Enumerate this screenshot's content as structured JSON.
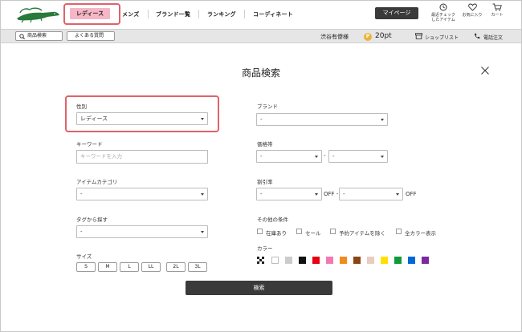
{
  "header": {
    "nav": {
      "ladies": "レディース",
      "mens": "メンズ",
      "brands": "ブランド一覧",
      "ranking": "ランキング",
      "coordinate": "コーディネート"
    },
    "mypage": "マイページ",
    "recent_line1": "最近チェック",
    "recent_line2": "したアイテム",
    "favorites": "お気に入り",
    "cart": "カート"
  },
  "subbar": {
    "product_search": "商品検索",
    "faq": "よくある質問",
    "user": "渋谷有傻様",
    "points": "20pt",
    "shop_list": "ショップリスト",
    "phone_order": "電話注文"
  },
  "panel": {
    "title": "商品検索",
    "gender_label": "性別",
    "gender_value": "レディース",
    "keyword_label": "キーワード",
    "keyword_placeholder": "キーワードを入力",
    "category_label": "アイテムカテゴリ",
    "category_value": "-",
    "tag_label": "タグから探す",
    "tag_value": "-",
    "size_label": "サイズ",
    "sizes": [
      "S",
      "M",
      "L",
      "LL",
      "2L",
      "3L"
    ],
    "brand_label": "ブランド",
    "brand_value": "-",
    "price_label": "価格帯",
    "price_min": "-",
    "price_max": "-",
    "price_dash": "-",
    "discount_label": "割引率",
    "discount_min": "-",
    "discount_max": "-",
    "off_text": "OFF -",
    "off_text_end": "OFF",
    "other_label": "その他の条件",
    "conditions": [
      "在庫あり",
      "セール",
      "予約アイテムを除く",
      "全カラー表示"
    ],
    "color_label": "カラー",
    "colors": [
      "#ffffff",
      "#cccccc",
      "#111111",
      "#e60012",
      "#f279b5",
      "#f08c1e",
      "#8b4513",
      "#e9cdbf",
      "#ffe100",
      "#109a38",
      "#0068d6",
      "#7b2a9e"
    ],
    "search_button": "検索"
  }
}
